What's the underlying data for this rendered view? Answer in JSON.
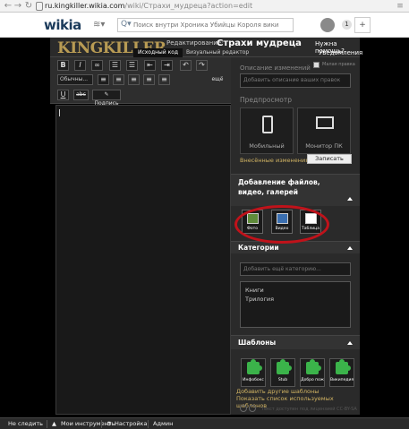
{
  "browser": {
    "url_host": "ru.kingkiller.wikia.com",
    "url_path": "/wiki/Страхи_мудреца?action=edit"
  },
  "header": {
    "logo": "wikia",
    "search_placeholder": "Поиск внутри Хроника Убийцы Короля вики",
    "notification_count": "1",
    "add_label": "+"
  },
  "edit_top": {
    "site_logo": "KINGKILLER",
    "editing_label": "Редактирование:",
    "page_title": "Страхи мудреца",
    "source_tab": "Исходный код",
    "visual_tab": "Визуальный редактор",
    "help": "Нужна помощь?",
    "notifications": "Уведомления"
  },
  "toolbar": {
    "bold": "B",
    "italic": "I",
    "link": "∞",
    "format_select": "Обычны...",
    "more": "ещё",
    "underline": "U",
    "strike": "abc",
    "signature": "Подпись"
  },
  "rail": {
    "summary_label": "Описание изменений",
    "minor_label": "Малая правка",
    "summary_placeholder": "Добавить описание ваших правок",
    "preview_label": "Предпросмотр",
    "mobile_label": "Мобильный",
    "desktop_label": "Монитор ПК",
    "changes_link": "Внесённые изменения",
    "save_button": "Записать",
    "media_section": "Добавление файлов, видео, галерей",
    "photo_label": "Фото",
    "video_label": "Видео",
    "table_label": "Таблица",
    "categories_section": "Категории",
    "category_placeholder": "Добавить ещё категорию...",
    "categories": [
      "Книги",
      "Трилогия"
    ],
    "templates_section": "Шаблоны",
    "templates": [
      "Инфобокс",
      "Stub",
      "Добро пож",
      "Википедия"
    ],
    "add_templates_link": "Добавить другие шаблоны",
    "show_templates_link": "Показать список используемых шаблонов",
    "license_text": "Текст доступен под лицензией CC-BY-SA"
  },
  "bottom_bar": {
    "follow": "Не следить",
    "tools": "Мои инструменты",
    "settings": "Настройка",
    "admin": "Админ"
  },
  "colors": {
    "accent_gold": "#d2b463",
    "annotation_red": "#c0121a",
    "template_green": "#3bb34a"
  }
}
